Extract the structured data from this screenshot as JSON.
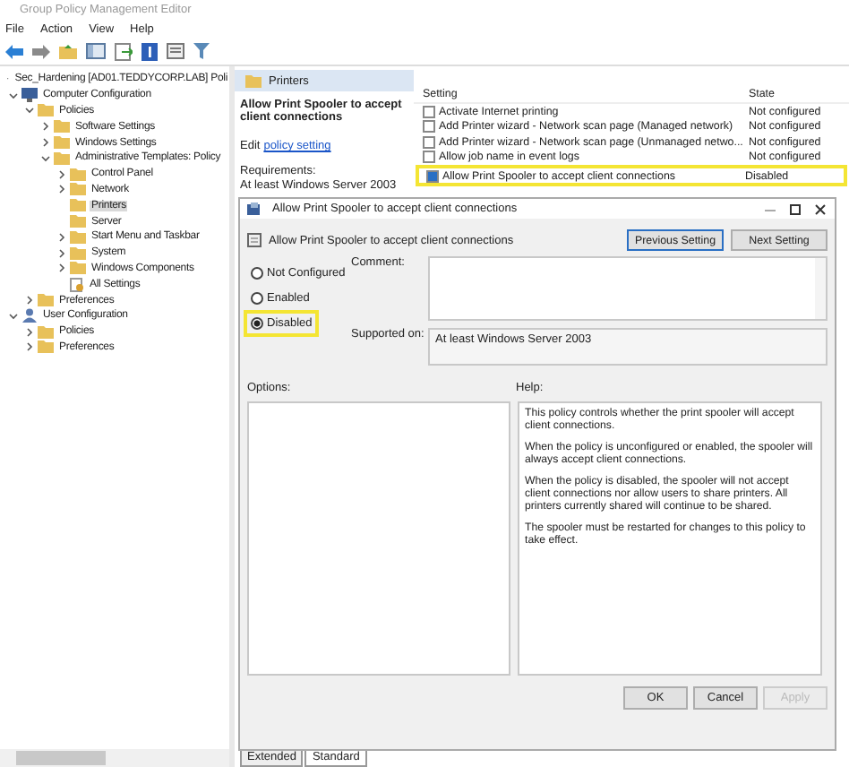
{
  "window": {
    "title": "Group Policy Management Editor"
  },
  "menu": [
    "File",
    "Action",
    "View",
    "Help"
  ],
  "tree": [
    {
      "label": "Sec_Hardening [AD01.TEDDYCORP.LAB] Poli",
      "kind": "gpo",
      "selected": false,
      "children": [
        {
          "label": "Computer Configuration",
          "kind": "computer",
          "selected": false,
          "expanded": true,
          "children": [
            {
              "label": "Policies",
              "kind": "folder",
              "selected": false,
              "expanded": true,
              "children": [
                {
                  "label": "Software Settings",
                  "kind": "folder",
                  "selected": false,
                  "expanded": false
                },
                {
                  "label": "Windows Settings",
                  "kind": "folder",
                  "selected": false,
                  "expanded": false
                },
                {
                  "label": "Administrative Templates: Policy",
                  "kind": "folder",
                  "selected": false,
                  "expanded": true,
                  "children": [
                    {
                      "label": "Control Panel",
                      "kind": "folder",
                      "selected": false,
                      "expanded": false
                    },
                    {
                      "label": "Network",
                      "kind": "folder",
                      "selected": false,
                      "expanded": false
                    },
                    {
                      "label": "Printers",
                      "kind": "folder",
                      "selected": true
                    },
                    {
                      "label": "Server",
                      "kind": "folder",
                      "selected": false
                    },
                    {
                      "label": "Start Menu and Taskbar",
                      "kind": "folder",
                      "selected": false,
                      "expanded": false
                    },
                    {
                      "label": "System",
                      "kind": "folder",
                      "selected": false,
                      "expanded": false
                    },
                    {
                      "label": "Windows Components",
                      "kind": "folder",
                      "selected": false,
                      "expanded": false
                    },
                    {
                      "label": "All Settings",
                      "kind": "allsettings",
                      "selected": false
                    }
                  ]
                }
              ]
            },
            {
              "label": "Preferences",
              "kind": "folder",
              "selected": false,
              "expanded": false
            }
          ]
        },
        {
          "label": "User Configuration",
          "kind": "user",
          "selected": false,
          "expanded": true,
          "children": [
            {
              "label": "Policies",
              "kind": "folder",
              "selected": false,
              "expanded": false
            },
            {
              "label": "Preferences",
              "kind": "folder",
              "selected": false,
              "expanded": false
            }
          ]
        }
      ]
    }
  ],
  "panel": {
    "title": "Printers",
    "heading": "Allow Print Spooler to accept client connections",
    "edit_prefix": "Edit",
    "edit_link": "policy setting",
    "requirements_label": "Requirements:",
    "requirements": "At least Windows Server 2003"
  },
  "settings": {
    "columns": [
      "Setting",
      "State"
    ],
    "rows": [
      {
        "name": "Activate Internet printing",
        "state": "Not configured",
        "selected": false
      },
      {
        "name": "Add Printer wizard - Network scan page (Managed network)",
        "state": "Not configured",
        "selected": false
      },
      {
        "name": "Add Printer wizard - Network scan page (Unmanaged netwo...",
        "state": "Not configured",
        "selected": false
      },
      {
        "name": "Allow job name in event logs",
        "state": "Not configured",
        "selected": false
      },
      {
        "name": "Allow Print Spooler to accept client connections",
        "state": "Disabled",
        "selected": true
      }
    ]
  },
  "dialog": {
    "title": "Allow Print Spooler to accept client connections",
    "heading": "Allow Print Spooler to accept client connections",
    "nav_buttons": [
      "Previous Setting",
      "Next Setting"
    ],
    "radios": [
      {
        "label": "Not Configured",
        "selected": false,
        "highlighted": false
      },
      {
        "label": "Enabled",
        "selected": false,
        "highlighted": false
      },
      {
        "label": "Disabled",
        "selected": true,
        "highlighted": true
      }
    ],
    "comment_label": "Comment:",
    "supported_label": "Supported on:",
    "supported_value": "At least Windows Server 2003",
    "options_label": "Options:",
    "help_label": "Help:",
    "help": [
      "This policy controls whether the print spooler will accept client connections.",
      "When the policy is unconfigured or enabled, the spooler will always accept client connections.",
      "When the policy is disabled, the spooler will not accept client connections nor allow users to share printers.  All printers currently shared will continue to be shared.",
      "The spooler must be restarted for changes to this policy to take effect."
    ],
    "buttons": [
      {
        "label": "OK",
        "disabled": false
      },
      {
        "label": "Cancel",
        "disabled": false
      },
      {
        "label": "Apply",
        "disabled": true
      }
    ]
  },
  "view_tabs": [
    {
      "label": "Extended",
      "selected": false
    },
    {
      "label": "Standard",
      "selected": true
    }
  ]
}
